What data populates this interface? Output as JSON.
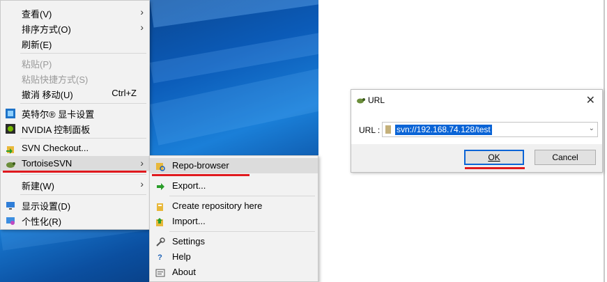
{
  "context_menu": {
    "items": [
      {
        "label": "查看(V)",
        "submenu": true
      },
      {
        "label": "排序方式(O)",
        "submenu": true
      },
      {
        "label": "刷新(E)"
      },
      {
        "label": "粘贴(P)",
        "disabled": true
      },
      {
        "label": "粘贴快捷方式(S)",
        "disabled": true
      },
      {
        "label": "撤消 移动(U)",
        "shortcut": "Ctrl+Z"
      },
      {
        "label": "英特尔® 显卡设置",
        "icon": "intel-graphics-icon"
      },
      {
        "label": "NVIDIA 控制面板",
        "icon": "nvidia-icon"
      },
      {
        "label": "SVN Checkout...",
        "icon": "svn-checkout-icon"
      },
      {
        "label": "TortoiseSVN",
        "icon": "tortoisesvn-icon",
        "submenu": true,
        "highlighted": true
      },
      {
        "label": "新建(W)",
        "submenu": true
      },
      {
        "label": "显示设置(D)",
        "icon": "display-settings-icon"
      },
      {
        "label": "个性化(R)",
        "icon": "personalize-icon"
      }
    ]
  },
  "submenu": {
    "items": [
      {
        "label": "Repo-browser",
        "icon": "repo-browser-icon",
        "highlighted": true
      },
      {
        "label": "Export...",
        "icon": "export-icon"
      },
      {
        "label": "Create repository here",
        "icon": "create-repo-icon"
      },
      {
        "label": "Import...",
        "icon": "import-icon"
      },
      {
        "label": "Settings",
        "icon": "settings-icon"
      },
      {
        "label": "Help",
        "icon": "help-icon"
      },
      {
        "label": "About",
        "icon": "about-icon"
      }
    ]
  },
  "dialog": {
    "title": "URL",
    "url_label": "URL :",
    "url_value": "svn://192.168.74.128/test",
    "ok_label": "OK",
    "cancel_label": "Cancel"
  },
  "colors": {
    "annotation_underline": "#e0191e",
    "selection": "#0a64d6",
    "menu_bg": "#f2f2f2"
  }
}
